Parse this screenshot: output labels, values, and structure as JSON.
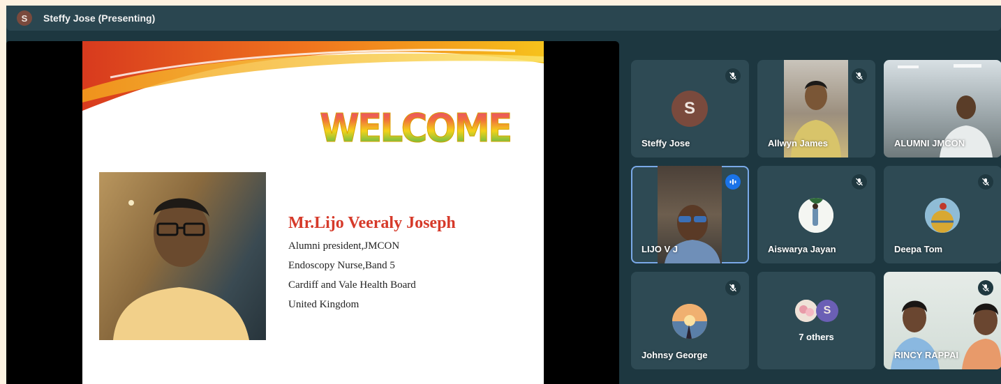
{
  "header": {
    "presenter_initial": "S",
    "presenter_label": "Steffy Jose (Presenting)"
  },
  "slide": {
    "heading": "WELCOME",
    "speaker_name": "Mr.Lijo Veeraly Joseph",
    "lines": [
      "Alumni president,JMCON",
      "Endoscopy Nurse,Band 5",
      "Cardiff and Vale Health Board",
      "United Kingdom"
    ]
  },
  "participants": [
    {
      "name": "Steffy Jose",
      "initial": "S",
      "mic": "muted",
      "avatar_color": "#7a4a3d"
    },
    {
      "name": "Allwyn James",
      "mic": "muted"
    },
    {
      "name": "ALUMNI JMCON",
      "mic": "none"
    },
    {
      "name": "LIJO V J",
      "mic": "speaking"
    },
    {
      "name": "Aiswarya Jayan",
      "mic": "muted"
    },
    {
      "name": "Deepa Tom",
      "mic": "muted"
    },
    {
      "name": "Johnsy George",
      "mic": "muted"
    },
    {
      "others_label": "7 others",
      "initial": "S",
      "avatar_color": "#6b5fb5"
    },
    {
      "name": "RINCY RAPPAI",
      "mic": "muted"
    }
  ],
  "colors": {
    "background": "#1d3740",
    "tile": "#2e4a54",
    "speaking_accent": "#1a73e8",
    "speaker_name": "#d63a2a"
  }
}
